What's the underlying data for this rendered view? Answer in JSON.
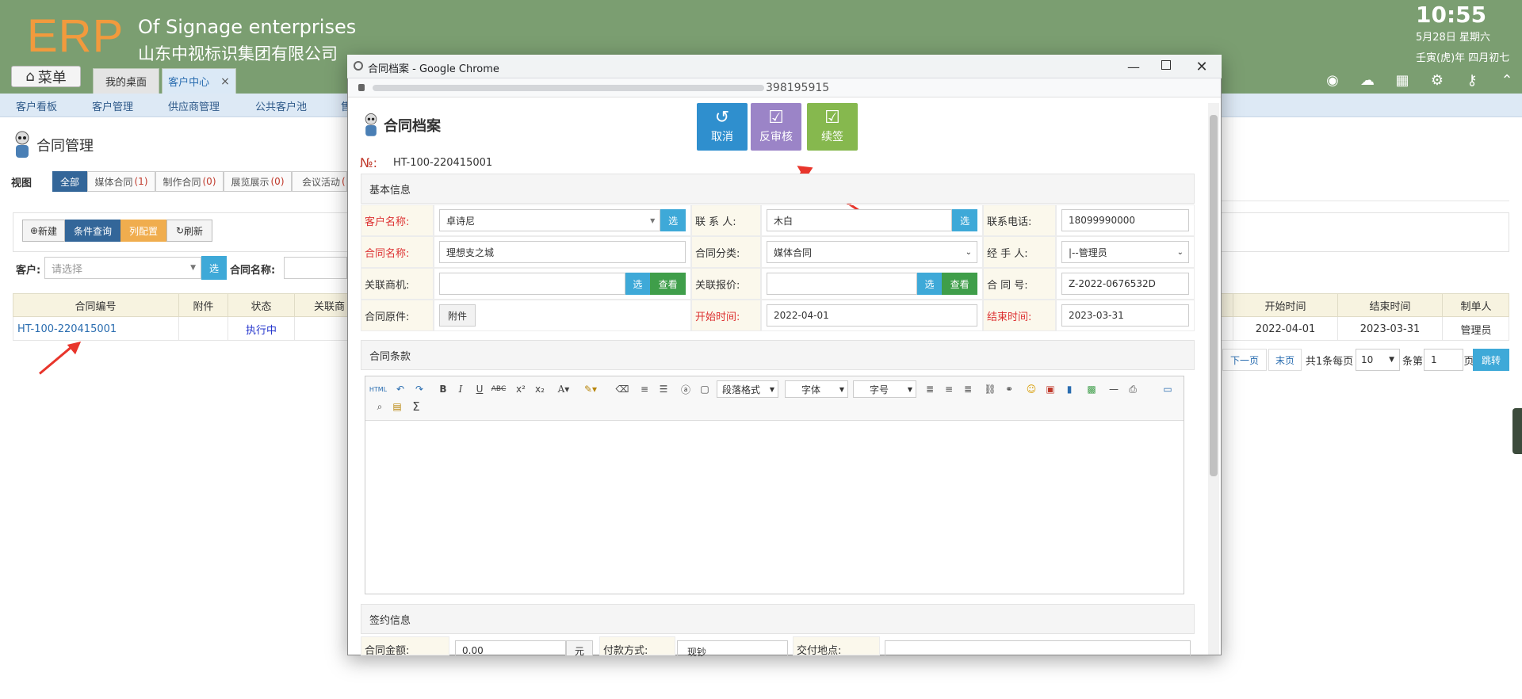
{
  "header": {
    "logo": "ERP",
    "company_en": "Of Signage enterprises",
    "company_cn": "山东中视标识集团有限公司",
    "time": "10:55",
    "date": "5月28日 星期六",
    "lunar": "壬寅(虎)年 四月初七",
    "menu_label": "菜单",
    "tabs": [
      {
        "label": "我的桌面"
      },
      {
        "label": "客户中心"
      }
    ],
    "tab_close": "×",
    "icons": [
      "user-icon",
      "cloud-icon",
      "apps-icon",
      "gear-icon",
      "key-icon",
      "collapse-icon"
    ]
  },
  "nav": {
    "items": [
      "客户看板",
      "客户管理",
      "供应商管理",
      "公共客户池",
      "售"
    ]
  },
  "page": {
    "title": "合同管理",
    "view_label": "视图",
    "filters": [
      {
        "label": "全部",
        "count": ""
      },
      {
        "label": "媒体合同",
        "count": "(1)"
      },
      {
        "label": "制作合同",
        "count": "(0)"
      },
      {
        "label": "展览展示",
        "count": "(0)"
      },
      {
        "label": "会议活动",
        "count": "("
      }
    ],
    "toolbar": {
      "new": "新建",
      "query": "条件查询",
      "columns": "列配置",
      "refresh": "刷新"
    },
    "search": {
      "customer_label": "客户:",
      "customer_placeholder": "请选择",
      "select_btn": "选",
      "contract_name_label": "合同名称:"
    },
    "grid": {
      "columns": [
        "合同编号",
        "附件",
        "状态",
        "关联商",
        "开始时间",
        "结束时间",
        "制单人"
      ],
      "rows": [
        {
          "no": "HT-100-220415001",
          "attach": "",
          "status": "执行中",
          "start": "2022-04-01",
          "end": "2023-03-31",
          "maker": "管理员"
        }
      ]
    },
    "pager": {
      "next": "下一页",
      "last": "末页",
      "summary": "共1条每页",
      "page_size": "10",
      "per_page_suffix": "条第",
      "page": "1",
      "page_suffix": "页",
      "jump": "跳转"
    }
  },
  "popup": {
    "window_title": "合同档案 - Google Chrome",
    "url_tail": "398195915",
    "heading": "合同档案",
    "actions": [
      {
        "label": "取消"
      },
      {
        "label": "反审核"
      },
      {
        "label": "续签"
      }
    ],
    "no_label": "№:",
    "no_value": "HT-100-220415001",
    "basic_section": "基本信息",
    "fields": {
      "customer_name": {
        "label": "客户名称:",
        "value": "卓诗尼"
      },
      "contact": {
        "label": "联 系 人:",
        "value": "木白"
      },
      "phone": {
        "label": "联系电话:",
        "value": "18099990000"
      },
      "contract_name": {
        "label": "合同名称:",
        "value": "理想支之城"
      },
      "category": {
        "label": "合同分类:",
        "value": "媒体合同"
      },
      "handler": {
        "label": "经 手 人:",
        "value": "|--管理员"
      },
      "opportunity": {
        "label": "关联商机:",
        "value": ""
      },
      "quote": {
        "label": "关联报价:",
        "value": ""
      },
      "contract_no": {
        "label": "合 同 号:",
        "value": "Z-2022-0676532D"
      },
      "original": {
        "label": "合同原件:",
        "button": "附件"
      },
      "start_time": {
        "label": "开始时间:",
        "value": "2022-04-01"
      },
      "end_time": {
        "label": "结束时间:",
        "value": "2023-03-31"
      }
    },
    "select_btn": "选",
    "view_btn": "查看",
    "terms_section": "合同条款",
    "editor": {
      "para": "段落格式",
      "font": "字体",
      "size": "字号",
      "html": "HTML"
    },
    "sign_section": "签约信息",
    "sign_fields": {
      "amount_label": "合同金额:",
      "amount_value": "0.00",
      "amount_unit": "元",
      "pay_label": "付款方式:",
      "pay_value": "现钞",
      "place_label": "交付地点:"
    }
  },
  "colors": {
    "header_bg": "#7b9e71",
    "logo": "#f29a3d",
    "primary_blue": "#336699",
    "select_blue": "#3ea9d8",
    "view_green": "#3f9e4a",
    "cancel_btn": "#2f8fce",
    "unaudit_btn": "#9b84c7",
    "renew_btn": "#86b84e",
    "arrow_red": "#e8352b"
  }
}
